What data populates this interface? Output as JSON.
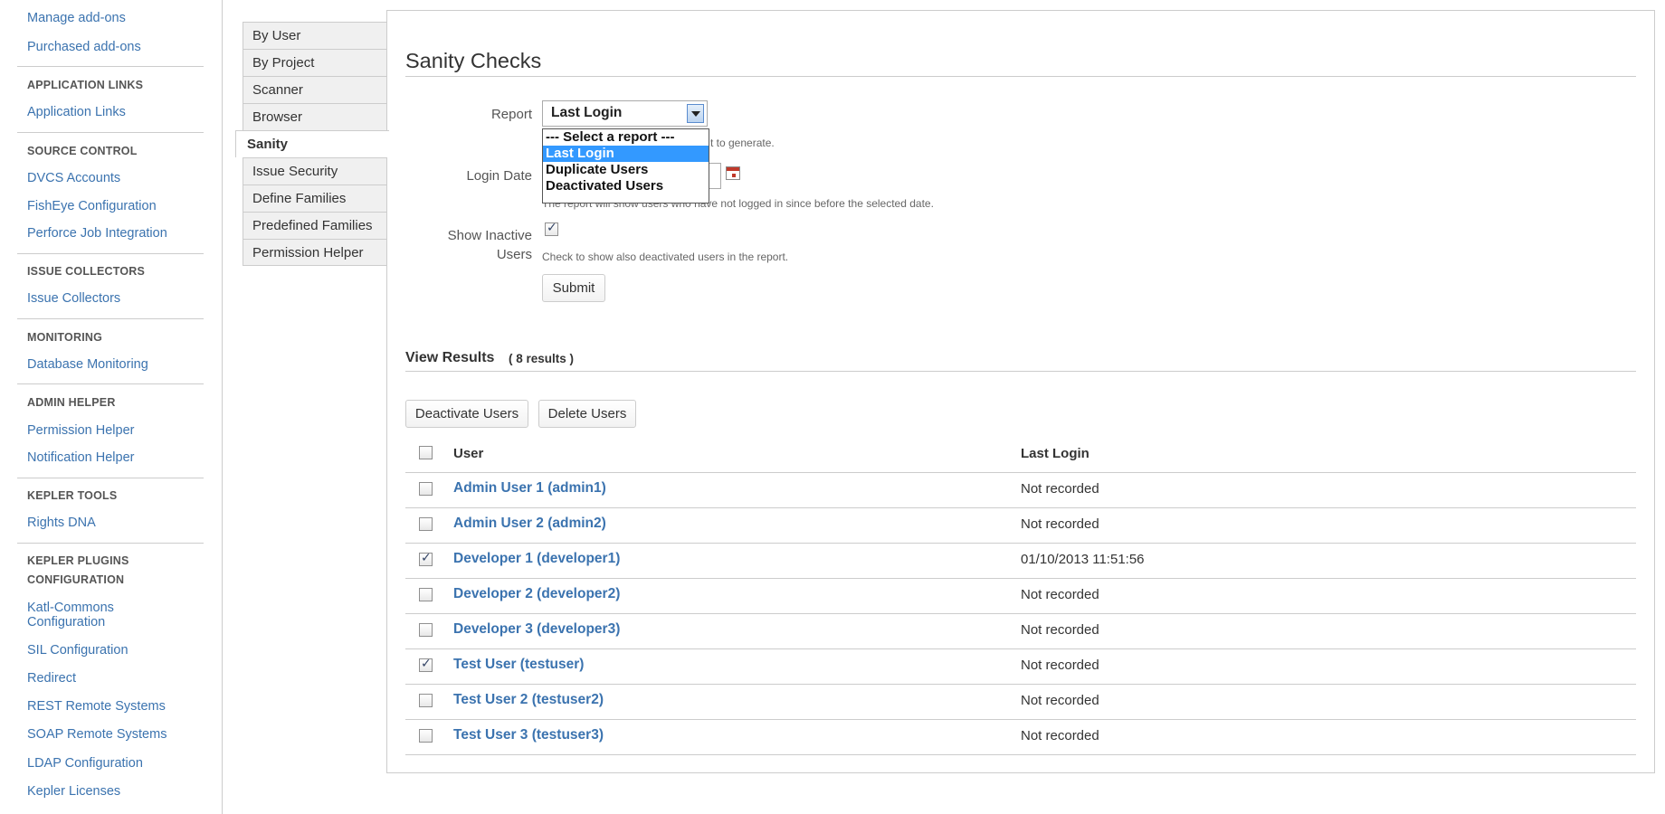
{
  "sidebar": {
    "top_links": [
      "Manage add-ons",
      "Purchased add-ons"
    ],
    "sections": [
      {
        "heading": "APPLICATION LINKS",
        "links": [
          "Application Links"
        ]
      },
      {
        "heading": "SOURCE CONTROL",
        "links": [
          "DVCS Accounts",
          "FishEye Configuration",
          "Perforce Job Integration"
        ]
      },
      {
        "heading": "ISSUE COLLECTORS",
        "links": [
          "Issue Collectors"
        ]
      },
      {
        "heading": "MONITORING",
        "links": [
          "Database Monitoring"
        ]
      },
      {
        "heading": "ADMIN HELPER",
        "links": [
          "Permission Helper",
          "Notification Helper"
        ]
      },
      {
        "heading": "KEPLER TOOLS",
        "links": [
          "Rights DNA"
        ]
      },
      {
        "heading": "KEPLER PLUGINS",
        "heading2": "CONFIGURATION",
        "links": [
          "Katl-Commons",
          "SIL Configuration",
          "Redirect",
          "REST Remote Systems",
          "SOAP Remote Systems",
          "LDAP Configuration",
          "Kepler Licenses"
        ],
        "katl_line2": "Configuration"
      }
    ]
  },
  "tabs": [
    "By User",
    "By Project",
    "Scanner",
    "Browser",
    "Sanity",
    "Issue Security",
    "Define Families",
    "Predefined Families",
    "Permission Helper"
  ],
  "active_tab": "Sanity",
  "page": {
    "title": "Sanity Checks",
    "report_label": "Report",
    "report_value": "Last Login",
    "report_desc_visible": "t to generate.",
    "report_options": [
      "--- Select a report ---",
      "Last Login",
      "Duplicate Users",
      "Deactivated Users"
    ],
    "login_date_label": "Login Date",
    "login_date_value": "",
    "login_date_desc": "The report will show users who have not logged in since before the selected date.",
    "inactive_label_1": "Show Inactive",
    "inactive_label_2": "Users",
    "inactive_desc": "Check to show also deactivated users in the report.",
    "submit_label": "Submit"
  },
  "results": {
    "title": "View Results",
    "count": "( 8 results )",
    "deactivate_label": "Deactivate Users",
    "delete_label": "Delete Users",
    "col_user": "User",
    "col_login": "Last Login",
    "rows": [
      {
        "user": "Admin User 1 (admin1)",
        "login": "Not recorded",
        "checked": false
      },
      {
        "user": "Admin User 2 (admin2)",
        "login": "Not recorded",
        "checked": false
      },
      {
        "user": "Developer 1 (developer1)",
        "login": "01/10/2013 11:51:56",
        "checked": true
      },
      {
        "user": "Developer 2 (developer2)",
        "login": "Not recorded",
        "checked": false
      },
      {
        "user": "Developer 3 (developer3)",
        "login": "Not recorded",
        "checked": false
      },
      {
        "user": "Test User (testuser)",
        "login": "Not recorded",
        "checked": true
      },
      {
        "user": "Test User 2 (testuser2)",
        "login": "Not recorded",
        "checked": false
      },
      {
        "user": "Test User 3 (testuser3)",
        "login": "Not recorded",
        "checked": false
      }
    ]
  },
  "colors": {
    "link": "#3b73af",
    "selected_option": "#3399ff",
    "border": "#cccccc"
  }
}
